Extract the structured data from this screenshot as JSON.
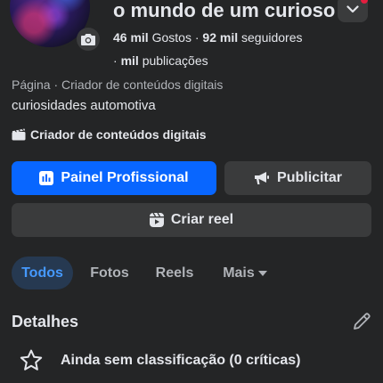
{
  "header": {
    "page_name": "o mundo de um curioso",
    "likes_count": "46 mil",
    "likes_label": "Gostos",
    "separator": "·",
    "followers_count": "92 mil",
    "followers_label": "seguidores",
    "publications_count": "mil",
    "publications_label": "publicações",
    "pub_prefix": "·"
  },
  "profile": {
    "category_line": "Página · Criador de conteúdos digitais",
    "bio": "curiosidades automotiva",
    "creator_badge": "Criador de conteúdos digitais"
  },
  "actions": {
    "primary_label": "Painel Profissional",
    "publicize_label": "Publicitar",
    "create_reel_label": "Criar reel"
  },
  "tabs": [
    {
      "label": "Todos",
      "active": true
    },
    {
      "label": "Fotos",
      "active": false
    },
    {
      "label": "Reels",
      "active": false
    },
    {
      "label": "Mais",
      "active": false
    }
  ],
  "details": {
    "title": "Detalhes",
    "rating_text": "Ainda sem classificação (0 críticas)"
  },
  "icons": {
    "camera": "camera-icon",
    "dropdown": "chevron-down-icon",
    "creator": "clapperboard-icon",
    "dashboard": "bar-chart-icon",
    "megaphone": "megaphone-icon",
    "reel": "reel-icon",
    "caret": "caret-down-icon",
    "edit": "pencil-icon",
    "star": "star-outline-icon"
  },
  "colors": {
    "background": "#242526",
    "primary": "#0866ff",
    "secondary_button": "#3a3b3c",
    "active_tab_bg": "#263951",
    "active_tab_text": "#4599ff",
    "notification": "#e41e3f"
  }
}
